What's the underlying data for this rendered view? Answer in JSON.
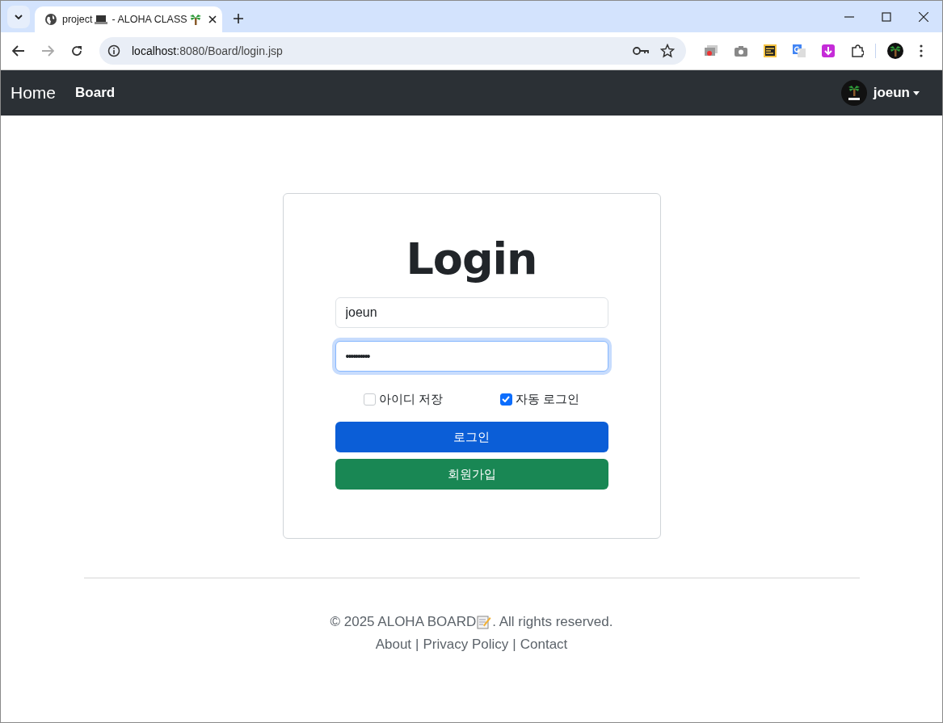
{
  "browser": {
    "tab": {
      "title_parts": [
        "project",
        " - ALOHA CLASS"
      ],
      "selected": true
    },
    "url_host": "localhost",
    "url_rest": ":8080/Board/login.jsp"
  },
  "navbar": {
    "brand": "Home",
    "links": [
      "Board"
    ],
    "user": "joeun"
  },
  "login": {
    "title": "Login",
    "fields": [
      {
        "kind": "text",
        "value": "joeun",
        "focused": false
      },
      {
        "kind": "password",
        "value": "••••••••••",
        "focused": true
      }
    ],
    "options": [
      {
        "label": "아이디 저장",
        "checked": false
      },
      {
        "label": "자동 로그인",
        "checked": true
      }
    ],
    "buttons": [
      {
        "label": "로그인",
        "kind": "primary"
      },
      {
        "label": "회원가입",
        "kind": "success"
      }
    ]
  },
  "footer": {
    "copyright_before": "© 2025 ALOHA BOARD",
    "copyright_after": ". All rights reserved.",
    "links": [
      "About",
      "Privacy Policy",
      "Contact"
    ],
    "separator": "|"
  }
}
